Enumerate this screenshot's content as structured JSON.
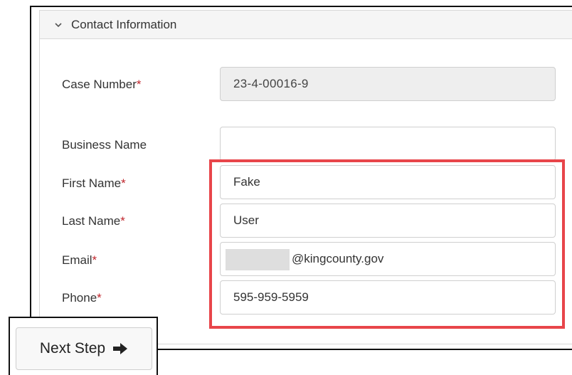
{
  "section": {
    "title": "Contact Information"
  },
  "form": {
    "case_number": {
      "label": "Case Number",
      "required_mark": "*",
      "value": "23-4-00016-9"
    },
    "business_name": {
      "label": "Business Name",
      "value": ""
    },
    "first_name": {
      "label": "First Name",
      "required_mark": "*",
      "value": "Fake"
    },
    "last_name": {
      "label": "Last Name",
      "required_mark": "*",
      "value": "User"
    },
    "email": {
      "label": "Email",
      "required_mark": "*",
      "value": "@kingcounty.gov"
    },
    "phone": {
      "label": "Phone",
      "required_mark": "*",
      "value": "595-959-5959"
    }
  },
  "actions": {
    "next_step_label": "Next Step"
  },
  "icons": {
    "section_toggle": "chevron-down-icon",
    "next": "arrow-right-icon"
  },
  "colors": {
    "required": "#c0262d",
    "highlight": "#e8454a",
    "readonly_bg": "#eeeeee"
  }
}
